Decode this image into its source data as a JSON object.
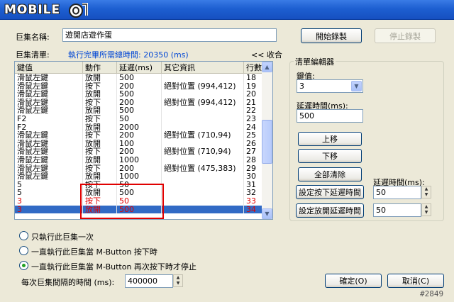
{
  "window": {
    "logo_text": "MOBILE",
    "title_color": "#1d5fd1"
  },
  "macro": {
    "name_label": "巨集名稱:",
    "name_value": "遊閒店遊作蛋",
    "record_button": "開始錄製",
    "stop_button": "停止錄製",
    "list_label": "巨集清單:",
    "total_time_text": "執行完畢所需總時間: 20350 (ms)",
    "collapse_link": "<< 收合"
  },
  "table": {
    "columns": [
      "鍵值",
      "動作",
      "延遲(ms)",
      "其它資訊",
      "行數"
    ],
    "rows": [
      {
        "key": "滑鼠左鍵",
        "action": "放開",
        "delay": "500",
        "info": "",
        "line": "18"
      },
      {
        "key": "滑鼠左鍵",
        "action": "按下",
        "delay": "200",
        "info": "絕對位置 (994,412)",
        "line": "19"
      },
      {
        "key": "滑鼠左鍵",
        "action": "放開",
        "delay": "500",
        "info": "",
        "line": "20"
      },
      {
        "key": "滑鼠左鍵",
        "action": "按下",
        "delay": "200",
        "info": "絕對位置 (994,412)",
        "line": "21"
      },
      {
        "key": "滑鼠左鍵",
        "action": "放開",
        "delay": "500",
        "info": "",
        "line": "22"
      },
      {
        "key": "F2",
        "action": "按下",
        "delay": "50",
        "info": "",
        "line": "23"
      },
      {
        "key": "F2",
        "action": "放開",
        "delay": "2000",
        "info": "",
        "line": "24"
      },
      {
        "key": "滑鼠左鍵",
        "action": "按下",
        "delay": "200",
        "info": "絕對位置 (710,94)",
        "line": "25"
      },
      {
        "key": "滑鼠左鍵",
        "action": "放開",
        "delay": "100",
        "info": "",
        "line": "26"
      },
      {
        "key": "滑鼠左鍵",
        "action": "按下",
        "delay": "200",
        "info": "絕對位置 (710,94)",
        "line": "27"
      },
      {
        "key": "滑鼠左鍵",
        "action": "放開",
        "delay": "1000",
        "info": "",
        "line": "28"
      },
      {
        "key": "滑鼠左鍵",
        "action": "按下",
        "delay": "200",
        "info": "絕對位置 (475,383)",
        "line": "29"
      },
      {
        "key": "滑鼠左鍵",
        "action": "放開",
        "delay": "1000",
        "info": "",
        "line": "30"
      },
      {
        "key": "5",
        "action": "按下",
        "delay": "50",
        "info": "",
        "line": "31"
      },
      {
        "key": "5",
        "action": "放開",
        "delay": "500",
        "info": "",
        "line": "32"
      },
      {
        "key": "3",
        "action": "按下",
        "delay": "50",
        "info": "",
        "line": "33",
        "style": "red"
      },
      {
        "key": "3",
        "action": "放開",
        "delay": "500",
        "info": "",
        "line": "34",
        "style": "sel"
      }
    ],
    "highlight_color": "#e00000",
    "selection_color": "#316ac5"
  },
  "editor": {
    "group_title": "清單編輯器",
    "key_label": "鍵值:",
    "key_value": "3",
    "delay_label": "延遲時間(ms):",
    "delay_value": "500",
    "move_up": "上移",
    "move_down": "下移",
    "clear_all": "全部清除",
    "set_press_delay": "設定按下延遲時間",
    "set_release_delay": "設定放開延遲時間",
    "delay_time_label": "延遲時間(ms):",
    "press_delay_value": "50",
    "release_delay_value": "50"
  },
  "options": {
    "run_once": "只執行此巨集一次",
    "run_while_held": "一直執行此巨集當 M-Button 按下時",
    "run_until_pressed": "一直執行此巨集當 M-Button 再次按下時才停止",
    "selected": 2,
    "interval_label": "每次巨集間隔的時間 (ms):",
    "interval_value": "400000"
  },
  "footer": {
    "ok_button": "確定(O)",
    "cancel_button": "取消(C)",
    "watermark": "#2849"
  }
}
